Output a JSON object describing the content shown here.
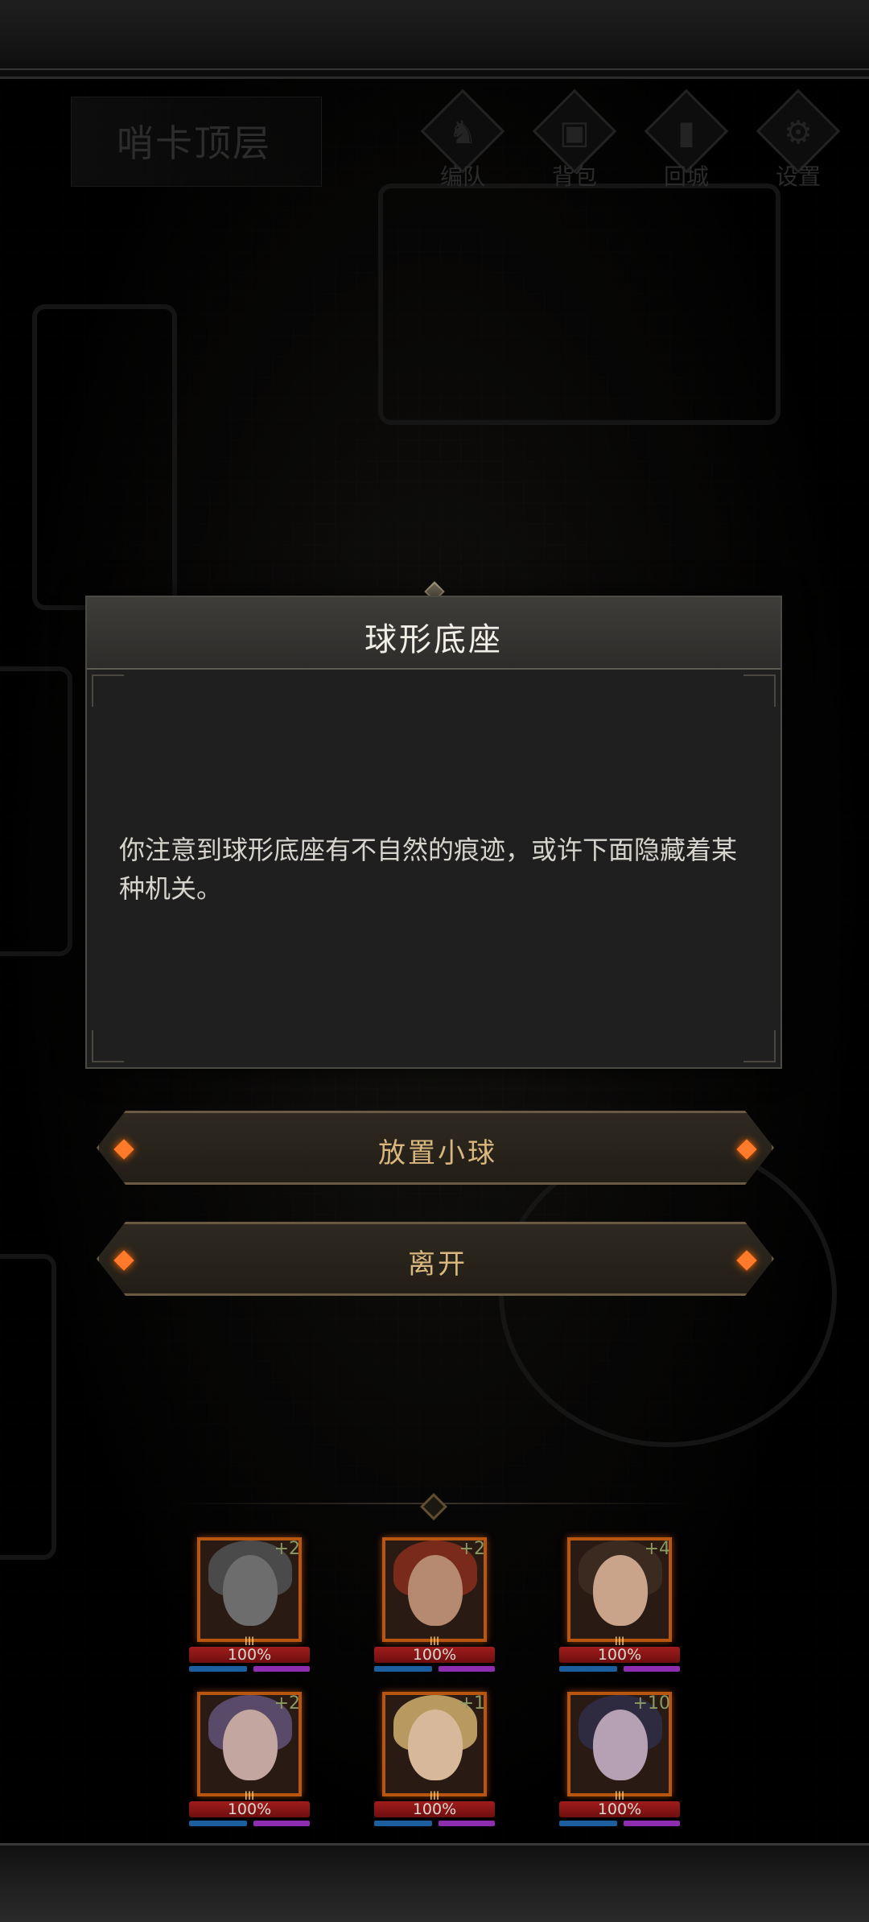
{
  "header": {
    "location": "哨卡顶层",
    "menu": [
      {
        "label": "编队",
        "icon": "horned-helmet-icon",
        "glyph": "♞"
      },
      {
        "label": "背包",
        "icon": "backpack-icon",
        "glyph": "▣"
      },
      {
        "label": "回城",
        "icon": "door-icon",
        "glyph": "▮"
      },
      {
        "label": "设置",
        "icon": "gear-icon",
        "glyph": "⚙"
      }
    ]
  },
  "dialog": {
    "title": "球形底座",
    "body": "你注意到球形底座有不自然的痕迹，或许下面隐藏着某种机关。"
  },
  "options": [
    {
      "label": "放置小球"
    },
    {
      "label": "离开"
    }
  ],
  "party": [
    {
      "level": "+2",
      "hp": "100%",
      "rank": "III"
    },
    {
      "level": "+2",
      "hp": "100%",
      "rank": "III"
    },
    {
      "level": "+4",
      "hp": "100%",
      "rank": "III"
    },
    {
      "level": "+2",
      "hp": "100%",
      "rank": "III"
    },
    {
      "level": "+1",
      "hp": "100%",
      "rank": "III"
    },
    {
      "level": "+10",
      "hp": "100%",
      "rank": "III"
    }
  ],
  "colors": {
    "accent": "#d9b77e",
    "portrait_border": "#b8550f",
    "hp": "#a01c1c",
    "mp": "#1c5f9e",
    "xp": "#8e2db0"
  }
}
